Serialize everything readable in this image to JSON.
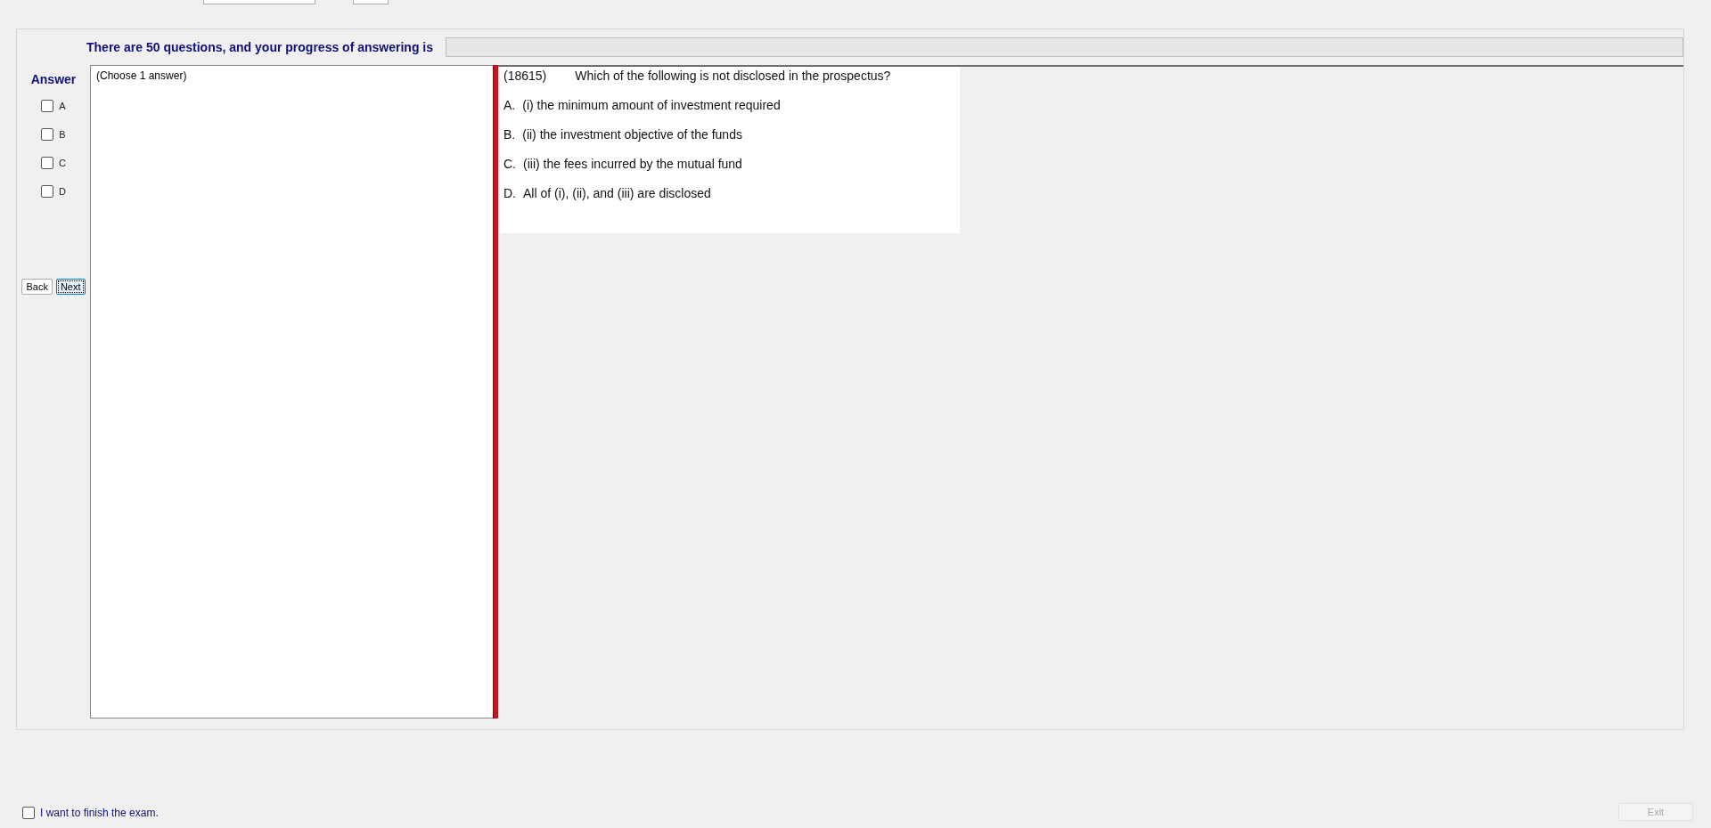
{
  "header": {
    "progress_text": "There are 50 questions, and your progress of answering is",
    "progress": {
      "level": 0
    }
  },
  "answer": {
    "title": "Answer",
    "options": [
      {
        "label": "A",
        "checked": false
      },
      {
        "label": "B",
        "checked": false
      },
      {
        "label": "C",
        "checked": false
      },
      {
        "label": "D",
        "checked": false
      }
    ]
  },
  "buttons": [
    {
      "label": "Back",
      "focused": false
    },
    {
      "label": "Next",
      "focused": true
    }
  ],
  "instruction": "(Choose 1 answer)",
  "question": {
    "number": "(18615)",
    "text": "Which of the following is not disclosed in the prospectus?",
    "choices": [
      {
        "letter": "A.",
        "text": "(i) the minimum amount of investment required"
      },
      {
        "letter": "B.",
        "text": "(ii) the investment objective of the funds"
      },
      {
        "letter": "C.",
        "text": "(iii) the fees incurred by the mutual fund"
      },
      {
        "letter": "D.",
        "text": "All of (i), (ii), and (iii) are disclosed"
      }
    ]
  },
  "finish": {
    "label": "I want to finish the exam.",
    "checked": false
  },
  "exit": {
    "label": "Exit",
    "disabled": true
  }
}
